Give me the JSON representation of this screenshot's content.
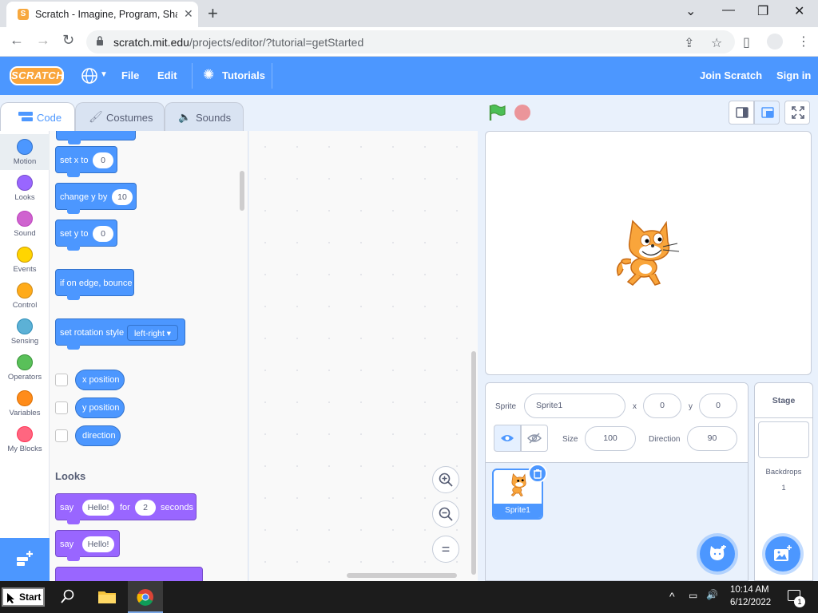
{
  "browser": {
    "tab_title": "Scratch - Imagine, Program, Share",
    "url_host": "scratch.mit.edu",
    "url_path": "/projects/editor/?tutorial=getStarted",
    "new_tab_symbol": "+",
    "tab_close_symbol": "✕"
  },
  "menubar": {
    "logo": "SCRATCH",
    "file": "File",
    "edit": "Edit",
    "tutorials": "Tutorials",
    "join": "Join Scratch",
    "signin": "Sign in"
  },
  "tabs": {
    "code": "Code",
    "costumes": "Costumes",
    "sounds": "Sounds"
  },
  "categories": [
    {
      "label": "Motion",
      "color": "#4c97ff"
    },
    {
      "label": "Looks",
      "color": "#9966ff"
    },
    {
      "label": "Sound",
      "color": "#cf63cf"
    },
    {
      "label": "Events",
      "color": "#ffd500"
    },
    {
      "label": "Control",
      "color": "#ffab19"
    },
    {
      "label": "Sensing",
      "color": "#5cb1d6"
    },
    {
      "label": "Operators",
      "color": "#59c059"
    },
    {
      "label": "Variables",
      "color": "#ff8c1a"
    },
    {
      "label": "My Blocks",
      "color": "#ff6680"
    }
  ],
  "palette": {
    "set_x": {
      "label": "set x to",
      "value": "0"
    },
    "change_y": {
      "label": "change y by",
      "value": "10"
    },
    "set_y": {
      "label": "set y to",
      "value": "0"
    },
    "bounce": {
      "label": "if on edge, bounce"
    },
    "rotation": {
      "label": "set rotation style",
      "value": "left-right ▾"
    },
    "x_position": "x position",
    "y_position": "y position",
    "direction": "direction",
    "looks_heading": "Looks",
    "say_for": {
      "label1": "say",
      "value": "Hello!",
      "label2": "for",
      "secs": "2",
      "label3": "seconds"
    },
    "say": {
      "label": "say",
      "value": "Hello!"
    }
  },
  "zoom": {
    "in": "+",
    "out": "−",
    "reset": "="
  },
  "sprite_info": {
    "sprite_label": "Sprite",
    "sprite_name": "Sprite1",
    "x_label": "x",
    "x_value": "0",
    "y_label": "y",
    "y_value": "0",
    "size_label": "Size",
    "size_value": "100",
    "direction_label": "Direction",
    "direction_value": "90"
  },
  "sprite_list": [
    {
      "name": "Sprite1"
    }
  ],
  "stage_pane": {
    "title": "Stage",
    "backdrops_label": "Backdrops",
    "backdrops_count": "1"
  },
  "taskbar": {
    "start": "Start",
    "time": "10:14 AM",
    "date": "6/12/2022",
    "notifications": "1"
  }
}
